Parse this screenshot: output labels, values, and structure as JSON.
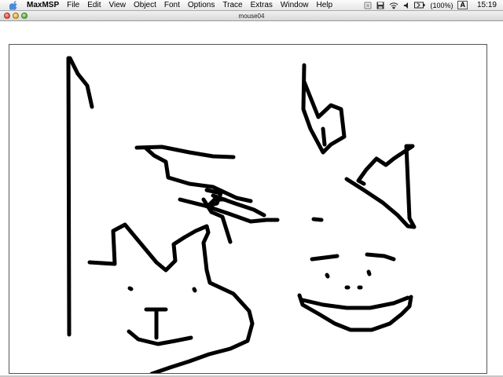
{
  "menubar": {
    "app_name": "MaxMSP",
    "items": [
      "File",
      "Edit",
      "View",
      "Object",
      "Font",
      "Options",
      "Trace",
      "Extras",
      "Window",
      "Help"
    ],
    "battery_text": "(100%)",
    "input_menu": "A",
    "clock": "15:19"
  },
  "window": {
    "title": "mouse04"
  },
  "colors": {
    "ink": "#000000",
    "canvas": "#ffffff"
  }
}
